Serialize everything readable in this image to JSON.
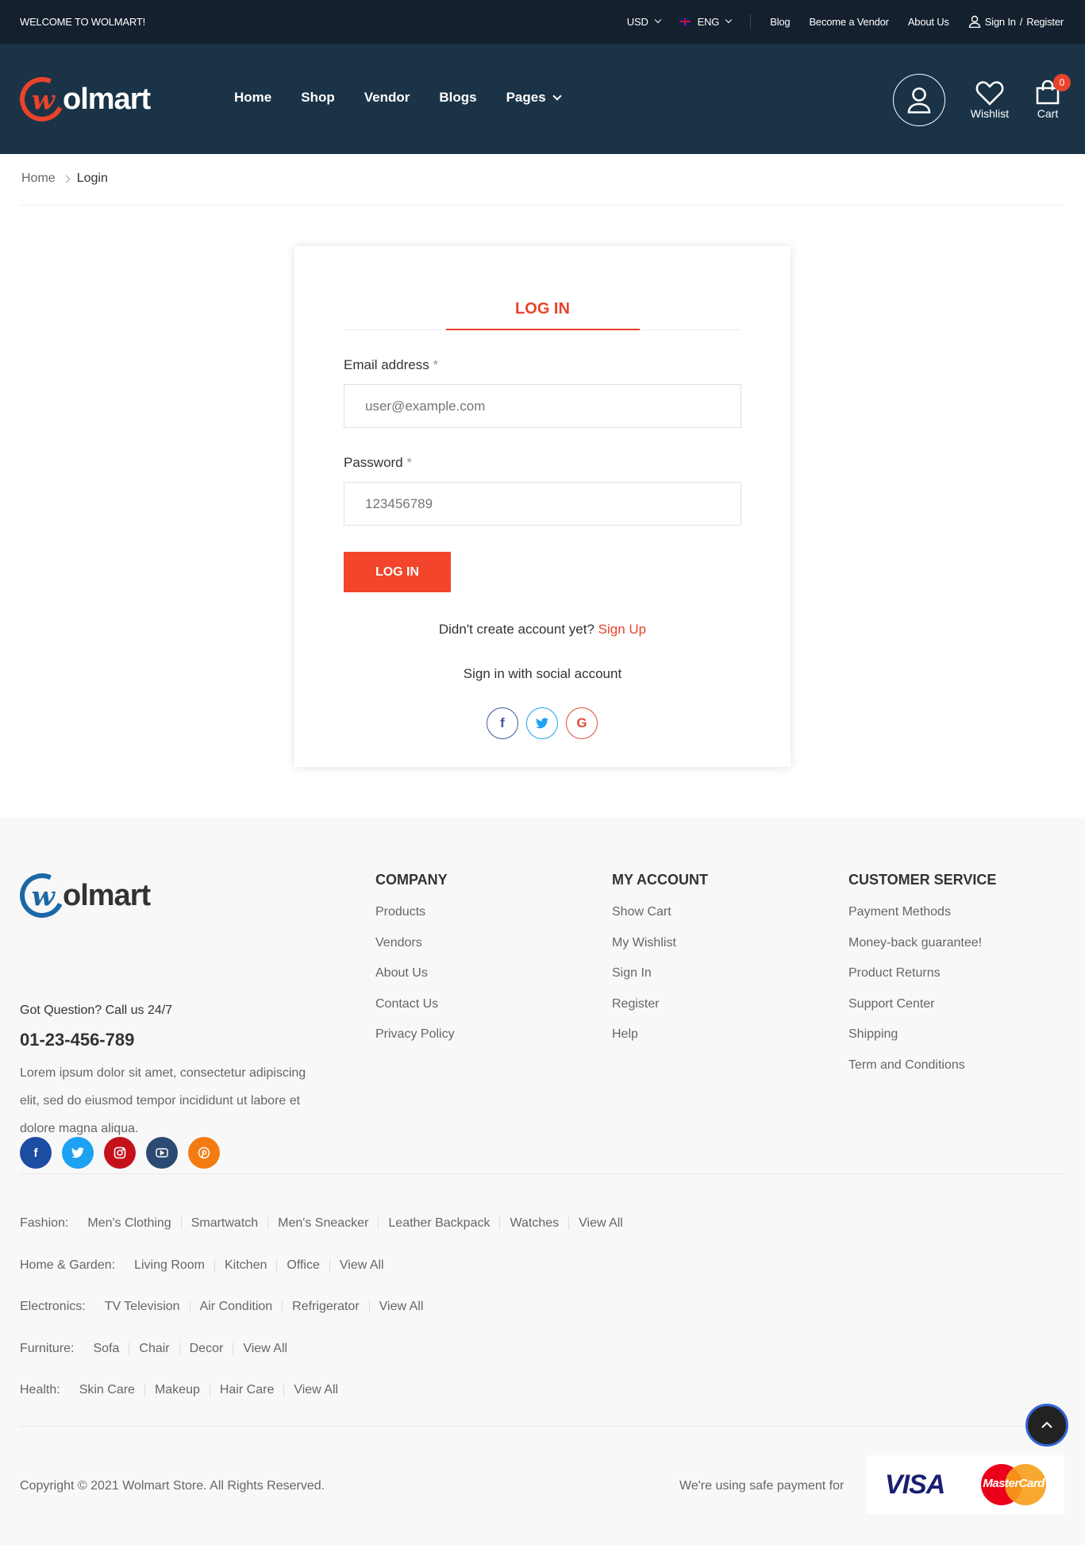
{
  "topbar": {
    "welcome": "WELCOME TO WOLMART!",
    "currency": "USD",
    "language": "ENG",
    "links": [
      "Blog",
      "Become a Vendor",
      "About Us"
    ],
    "sign_in": "Sign In",
    "slash": "/",
    "register": "Register"
  },
  "header": {
    "logo_text": "olmart",
    "nav": [
      "Home",
      "Shop",
      "Vendor",
      "Blogs",
      "Pages"
    ],
    "wishlist": "Wishlist",
    "cart": "Cart",
    "cart_count": "0"
  },
  "breadcrumb": {
    "home": "Home",
    "current": "Login"
  },
  "login": {
    "tab": "LOG IN",
    "email_label": "Email address",
    "required": "*",
    "email_placeholder": "user@example.com",
    "password_label": "Password",
    "password_placeholder": "123456789",
    "button": "LOG IN",
    "no_account": "Didn't create account yet?",
    "sign_up": "Sign Up",
    "social_text": "Sign in with social account"
  },
  "footer": {
    "logo_text": "olmart",
    "question": "Got Question? Call us 24/7",
    "phone": "01-23-456-789",
    "about": "Lorem ipsum dolor sit amet, consectetur adipiscing elit, sed do eiusmod tempor incididunt ut labore et dolore magna aliqua.",
    "columns": [
      {
        "title": "COMPANY",
        "links": [
          "Products",
          "Vendors",
          "About Us",
          "Contact Us",
          "Privacy Policy"
        ]
      },
      {
        "title": "MY ACCOUNT",
        "links": [
          "Show Cart",
          "My Wishlist",
          "Sign In",
          "Register",
          "Help"
        ]
      },
      {
        "title": "CUSTOMER SERVICE",
        "links": [
          "Payment Methods",
          "Money-back guarantee!",
          "Product Returns",
          "Support Center",
          "Shipping",
          "Term and Conditions"
        ]
      }
    ],
    "categories": [
      {
        "title": "Fashion:",
        "links": [
          "Men's Clothing",
          "Smartwatch",
          "Men's Sneacker",
          "Leather Backpack",
          "Watches",
          "View All"
        ]
      },
      {
        "title": "Home & Garden:",
        "links": [
          "Living Room",
          "Kitchen",
          "Office",
          "View All"
        ]
      },
      {
        "title": "Electronics:",
        "links": [
          "TV Television",
          "Air Condition",
          "Refrigerator",
          "View All"
        ]
      },
      {
        "title": "Furniture:",
        "links": [
          "Sofa",
          "Chair",
          "Decor",
          "View All"
        ]
      },
      {
        "title": "Health:",
        "links": [
          "Skin Care",
          "Makeup",
          "Hair Care",
          "View All"
        ]
      }
    ],
    "copyright": "Copyright © 2021 Wolmart Store. All Rights Reserved.",
    "safe_payment": "We're using safe payment for",
    "visa": "VISA",
    "mastercard": "MasterCard"
  },
  "colors": {
    "accent": "#e9432c",
    "header_bg": "#1a3346",
    "topbar_bg": "#15202e",
    "footer_bg": "#f8f8f8"
  }
}
